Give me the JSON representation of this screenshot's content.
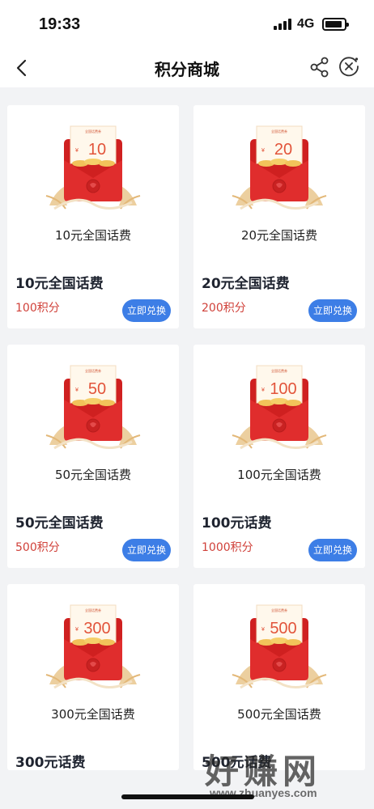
{
  "status_bar": {
    "time": "19:33",
    "network": "4G"
  },
  "nav": {
    "title": "积分商城"
  },
  "products": [
    {
      "amount": "10",
      "caption": "10元全国话费",
      "title": "10元全国话费",
      "points": "100积分",
      "button": "立即兑换"
    },
    {
      "amount": "20",
      "caption": "20元全国话费",
      "title": "20元全国话费",
      "points": "200积分",
      "button": "立即兑换"
    },
    {
      "amount": "50",
      "caption": "50元全国话费",
      "title": "50元全国话费",
      "points": "500积分",
      "button": "立即兑换"
    },
    {
      "amount": "100",
      "caption": "100元全国话费",
      "title": "100元话费",
      "points": "1000积分",
      "button": "立即兑换"
    },
    {
      "amount": "300",
      "caption": "300元全国话费",
      "title": "300元话费"
    },
    {
      "amount": "500",
      "caption": "500元全国话费",
      "title": "500元话费"
    }
  ],
  "watermark": {
    "brand": "好赚网",
    "url": "www.zhuanyes.com"
  },
  "colors": {
    "points": "#d0413a",
    "button": "#3d7ee6",
    "envelope": "#d82a2a",
    "background": "#f2f3f5"
  }
}
